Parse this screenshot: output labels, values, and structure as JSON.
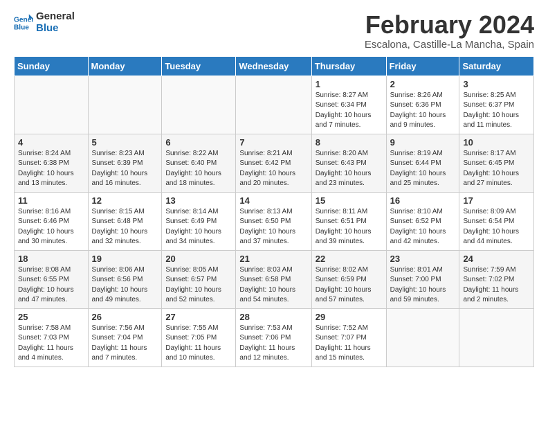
{
  "logo": {
    "line1": "General",
    "line2": "Blue"
  },
  "title": "February 2024",
  "subtitle": "Escalona, Castille-La Mancha, Spain",
  "headers": [
    "Sunday",
    "Monday",
    "Tuesday",
    "Wednesday",
    "Thursday",
    "Friday",
    "Saturday"
  ],
  "weeks": [
    [
      {
        "day": "",
        "details": ""
      },
      {
        "day": "",
        "details": ""
      },
      {
        "day": "",
        "details": ""
      },
      {
        "day": "",
        "details": ""
      },
      {
        "day": "1",
        "details": "Sunrise: 8:27 AM\nSunset: 6:34 PM\nDaylight: 10 hours\nand 7 minutes."
      },
      {
        "day": "2",
        "details": "Sunrise: 8:26 AM\nSunset: 6:36 PM\nDaylight: 10 hours\nand 9 minutes."
      },
      {
        "day": "3",
        "details": "Sunrise: 8:25 AM\nSunset: 6:37 PM\nDaylight: 10 hours\nand 11 minutes."
      }
    ],
    [
      {
        "day": "4",
        "details": "Sunrise: 8:24 AM\nSunset: 6:38 PM\nDaylight: 10 hours\nand 13 minutes."
      },
      {
        "day": "5",
        "details": "Sunrise: 8:23 AM\nSunset: 6:39 PM\nDaylight: 10 hours\nand 16 minutes."
      },
      {
        "day": "6",
        "details": "Sunrise: 8:22 AM\nSunset: 6:40 PM\nDaylight: 10 hours\nand 18 minutes."
      },
      {
        "day": "7",
        "details": "Sunrise: 8:21 AM\nSunset: 6:42 PM\nDaylight: 10 hours\nand 20 minutes."
      },
      {
        "day": "8",
        "details": "Sunrise: 8:20 AM\nSunset: 6:43 PM\nDaylight: 10 hours\nand 23 minutes."
      },
      {
        "day": "9",
        "details": "Sunrise: 8:19 AM\nSunset: 6:44 PM\nDaylight: 10 hours\nand 25 minutes."
      },
      {
        "day": "10",
        "details": "Sunrise: 8:17 AM\nSunset: 6:45 PM\nDaylight: 10 hours\nand 27 minutes."
      }
    ],
    [
      {
        "day": "11",
        "details": "Sunrise: 8:16 AM\nSunset: 6:46 PM\nDaylight: 10 hours\nand 30 minutes."
      },
      {
        "day": "12",
        "details": "Sunrise: 8:15 AM\nSunset: 6:48 PM\nDaylight: 10 hours\nand 32 minutes."
      },
      {
        "day": "13",
        "details": "Sunrise: 8:14 AM\nSunset: 6:49 PM\nDaylight: 10 hours\nand 34 minutes."
      },
      {
        "day": "14",
        "details": "Sunrise: 8:13 AM\nSunset: 6:50 PM\nDaylight: 10 hours\nand 37 minutes."
      },
      {
        "day": "15",
        "details": "Sunrise: 8:11 AM\nSunset: 6:51 PM\nDaylight: 10 hours\nand 39 minutes."
      },
      {
        "day": "16",
        "details": "Sunrise: 8:10 AM\nSunset: 6:52 PM\nDaylight: 10 hours\nand 42 minutes."
      },
      {
        "day": "17",
        "details": "Sunrise: 8:09 AM\nSunset: 6:54 PM\nDaylight: 10 hours\nand 44 minutes."
      }
    ],
    [
      {
        "day": "18",
        "details": "Sunrise: 8:08 AM\nSunset: 6:55 PM\nDaylight: 10 hours\nand 47 minutes."
      },
      {
        "day": "19",
        "details": "Sunrise: 8:06 AM\nSunset: 6:56 PM\nDaylight: 10 hours\nand 49 minutes."
      },
      {
        "day": "20",
        "details": "Sunrise: 8:05 AM\nSunset: 6:57 PM\nDaylight: 10 hours\nand 52 minutes."
      },
      {
        "day": "21",
        "details": "Sunrise: 8:03 AM\nSunset: 6:58 PM\nDaylight: 10 hours\nand 54 minutes."
      },
      {
        "day": "22",
        "details": "Sunrise: 8:02 AM\nSunset: 6:59 PM\nDaylight: 10 hours\nand 57 minutes."
      },
      {
        "day": "23",
        "details": "Sunrise: 8:01 AM\nSunset: 7:00 PM\nDaylight: 10 hours\nand 59 minutes."
      },
      {
        "day": "24",
        "details": "Sunrise: 7:59 AM\nSunset: 7:02 PM\nDaylight: 11 hours\nand 2 minutes."
      }
    ],
    [
      {
        "day": "25",
        "details": "Sunrise: 7:58 AM\nSunset: 7:03 PM\nDaylight: 11 hours\nand 4 minutes."
      },
      {
        "day": "26",
        "details": "Sunrise: 7:56 AM\nSunset: 7:04 PM\nDaylight: 11 hours\nand 7 minutes."
      },
      {
        "day": "27",
        "details": "Sunrise: 7:55 AM\nSunset: 7:05 PM\nDaylight: 11 hours\nand 10 minutes."
      },
      {
        "day": "28",
        "details": "Sunrise: 7:53 AM\nSunset: 7:06 PM\nDaylight: 11 hours\nand 12 minutes."
      },
      {
        "day": "29",
        "details": "Sunrise: 7:52 AM\nSunset: 7:07 PM\nDaylight: 11 hours\nand 15 minutes."
      },
      {
        "day": "",
        "details": ""
      },
      {
        "day": "",
        "details": ""
      }
    ]
  ]
}
